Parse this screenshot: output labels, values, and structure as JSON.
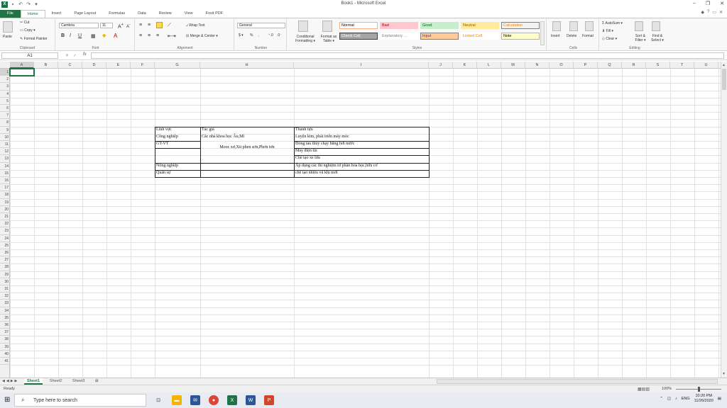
{
  "window": {
    "title": "Book1 - Microsoft Excel",
    "minimize": "–",
    "maximize": "❐",
    "close": "✕"
  },
  "app_icon": "X",
  "ribbon_tabs": [
    "File",
    "Home",
    "Insert",
    "Page Layout",
    "Formulas",
    "Data",
    "Review",
    "View",
    "Foxit PDF"
  ],
  "help_icons": [
    "◆",
    "?",
    "▭",
    "✕"
  ],
  "clipboard": {
    "paste": "Paste",
    "cut": "Cut",
    "copy": "Copy ▾",
    "format_painter": "Format Painter",
    "label": "Clipboard"
  },
  "font": {
    "name": "Cambria",
    "size": "11",
    "label": "Font",
    "bold": "B",
    "italic": "I",
    "underline": "U"
  },
  "alignment": {
    "wrap": "Wrap Text",
    "merge": "Merge & Center ▾",
    "label": "Alignment"
  },
  "number": {
    "format": "General",
    "label": "Number",
    "currency": "$ ▾",
    "percent": "%",
    "comma": ","
  },
  "styles": {
    "conditional": "Conditional Formatting ▾",
    "format_table": "Format as Table ▾",
    "label": "Styles",
    "items": [
      {
        "name": "Normal",
        "bg": "#ffffff",
        "fg": "#000000",
        "border": "#f4b183"
      },
      {
        "name": "Bad",
        "bg": "#ffc7ce",
        "fg": "#9c0006",
        "border": "#ffc7ce"
      },
      {
        "name": "Good",
        "bg": "#c6efce",
        "fg": "#006100",
        "border": "#c6efce"
      },
      {
        "name": "Neutral",
        "bg": "#ffeb9c",
        "fg": "#9c5700",
        "border": "#ffeb9c"
      },
      {
        "name": "Calculation",
        "bg": "#f2f2f2",
        "fg": "#fa7d00",
        "border": "#7f7f7f"
      },
      {
        "name": "Check Cell",
        "bg": "#a5a5a5",
        "fg": "#ffffff",
        "border": "#3f3f3f"
      },
      {
        "name": "Explanatory ...",
        "bg": "#ffffff",
        "fg": "#7f7f7f",
        "border": "#ffffff"
      },
      {
        "name": "Input",
        "bg": "#ffcc99",
        "fg": "#3f3f76",
        "border": "#7f7f7f"
      },
      {
        "name": "Linked Cell",
        "bg": "#ffffff",
        "fg": "#fa7d00",
        "border": "#ffffff"
      },
      {
        "name": "Note",
        "bg": "#ffffcc",
        "fg": "#000000",
        "border": "#b2b2b2"
      }
    ]
  },
  "cells": {
    "insert": "Insert",
    "delete": "Delete",
    "format": "Format",
    "label": "Cells"
  },
  "editing": {
    "autosum": "Σ AutoSum ▾",
    "fill": "Fill ▾",
    "clear": "Clear ▾",
    "sort": "Sort & Filter ▾",
    "find": "Find & Select ▾",
    "label": "Editing"
  },
  "formula_bar": {
    "name_box": "A1",
    "fx": "fx",
    "content": ""
  },
  "columns": [
    "A",
    "B",
    "C",
    "D",
    "E",
    "F",
    "G",
    "H",
    "I",
    "J",
    "K",
    "L",
    "M",
    "N",
    "O",
    "P",
    "Q",
    "R",
    "S",
    "T",
    "U"
  ],
  "rows": [
    "1",
    "2",
    "3",
    "4",
    "5",
    "6",
    "7",
    "8",
    "9",
    "10",
    "11",
    "12",
    "13",
    "14",
    "15",
    "16",
    "17",
    "18",
    "19",
    "20",
    "21",
    "22",
    "23",
    "24",
    "25",
    "26",
    "27",
    "28",
    "29",
    "30",
    "31",
    "32",
    "33",
    "34",
    "35",
    "36",
    "37",
    "38",
    "39",
    "40",
    "41"
  ],
  "table": {
    "g9": "Lĩnh vực",
    "h9": "Tác giả",
    "i9": "Thành tựu",
    "g10": "Công nghiệp",
    "h10": "Các nhà khoa học Âu,Mĩ",
    "i10": "Luyện kim, phát triển máy móc",
    "g11": "GT-VT",
    "h11": "Mooc xơ,Xti phen sơn,Phơn tơn",
    "i11": "Đóng tàu thủy chạy bằng hơi nước",
    "i12": "Máy điện tín",
    "i13": "Chế tạo xe lửa",
    "g14": "Nông nghiệp",
    "i14": "Áp dụng các thí nghiệm từ phân hóa học,hữu cơ",
    "g15": "Quân sự",
    "i15": "chế tạo nhiều vũ khí mới"
  },
  "sheets": [
    "Sheet1",
    "Sheet2",
    "Sheet3"
  ],
  "status": {
    "ready": "Ready",
    "zoom": "100%"
  },
  "taskbar": {
    "search_placeholder": "Type here to search",
    "time": "10:20 PM",
    "date": "11/26/2020",
    "lang": "ENG"
  }
}
